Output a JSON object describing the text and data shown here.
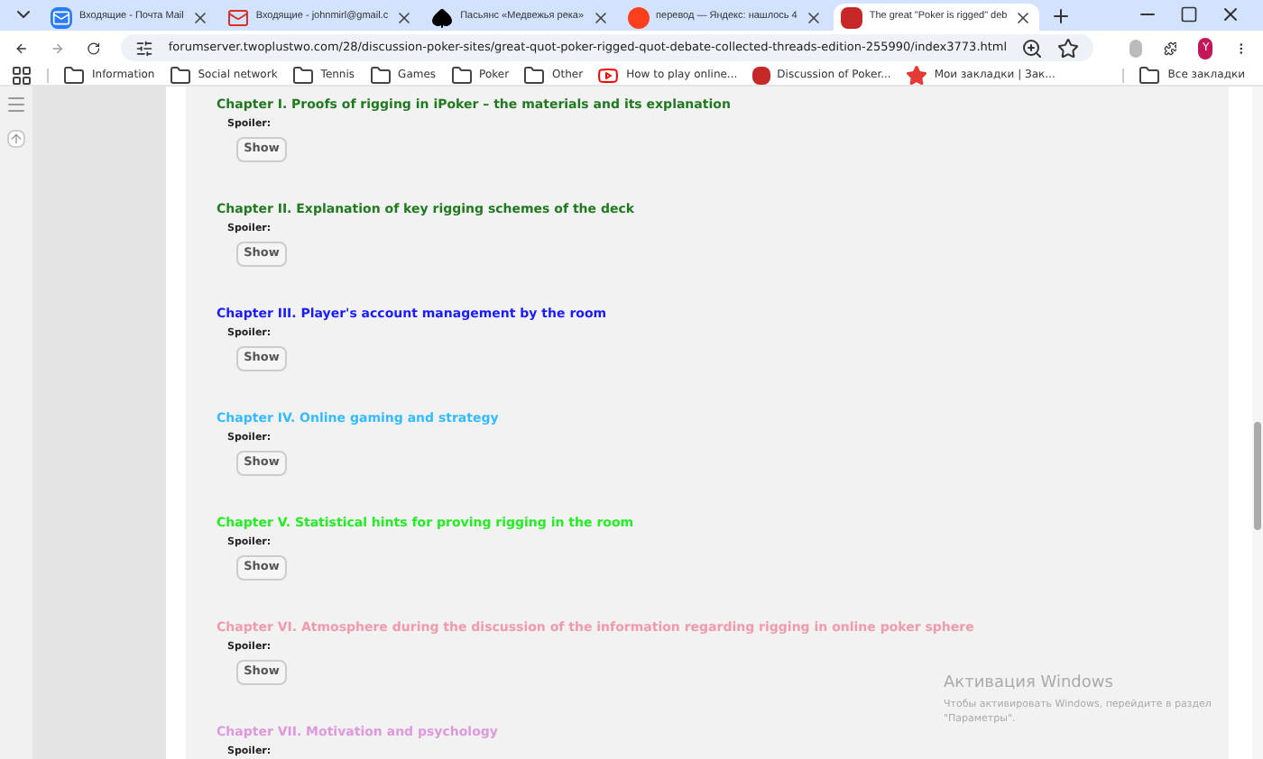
{
  "tabs": [
    {
      "title": "Входящие - Почта Mail",
      "kind": "mailru",
      "selected": false
    },
    {
      "title": "Входящие - johnmirl@gmail.c",
      "kind": "gmail",
      "selected": false
    },
    {
      "title": "Пасьянс «Медвежья река»",
      "kind": "spade",
      "selected": false
    },
    {
      "title": "перевод — Яндекс: нашлось 4",
      "kind": "yandex",
      "selected": false
    },
    {
      "title": "The great \"Poker is rigged\" deb",
      "kind": "site",
      "selected": true
    }
  ],
  "address": "forumserver.twoplustwo.com/28/discussion-poker-sites/great-quot-poker-rigged-quot-debate-collected-threads-edition-255990/index3773.html",
  "profile_initial": "Y",
  "bookmarks": [
    {
      "label": "Information",
      "kind": "folder"
    },
    {
      "label": "Social network",
      "kind": "folder"
    },
    {
      "label": "Tennis",
      "kind": "folder"
    },
    {
      "label": "Games",
      "kind": "folder"
    },
    {
      "label": "Poker",
      "kind": "folder"
    },
    {
      "label": "Other",
      "kind": "folder"
    },
    {
      "label": "How to play online...",
      "kind": "video"
    },
    {
      "label": "Discussion of Poker...",
      "kind": "site"
    },
    {
      "label": "Мои закладки | Зак...",
      "kind": "star"
    }
  ],
  "all_bookmarks": "Все закладки",
  "chapters": [
    {
      "title": "Chapter I. Proofs of rigging in iPoker – the materials and its explanation",
      "color": "#1f7a1f",
      "spoiler_label": "Spoiler:",
      "button": "Show"
    },
    {
      "title": "Chapter II. Explanation of key rigging schemes of the deck",
      "color": "#1f7a1f",
      "spoiler_label": "Spoiler:",
      "button": "Show"
    },
    {
      "title": "Chapter III. Player's account management by the room",
      "color": "#1a1aff",
      "spoiler_label": "Spoiler:",
      "button": "Show"
    },
    {
      "title": "Chapter IV. Online gaming and strategy",
      "color": "#33bbff",
      "spoiler_label": "Spoiler:",
      "button": "Show"
    },
    {
      "title": "Chapter V. Statistical hints for proving rigging in the room",
      "color": "#22ee22",
      "spoiler_label": "Spoiler:",
      "button": "Show"
    },
    {
      "title": "Chapter VI. Atmosphere during the discussion of the information regarding rigging in online poker sphere",
      "color": "#f29aab",
      "spoiler_label": "Spoiler:",
      "button": "Show"
    },
    {
      "title": "Chapter VII. Motivation and psychology",
      "color": "#dd99dd",
      "spoiler_label": "Spoiler:"
    }
  ],
  "activation": {
    "title": "Активация Windows",
    "text": "Чтобы активировать Windows, перейдите в раздел \"Параметры\"."
  }
}
